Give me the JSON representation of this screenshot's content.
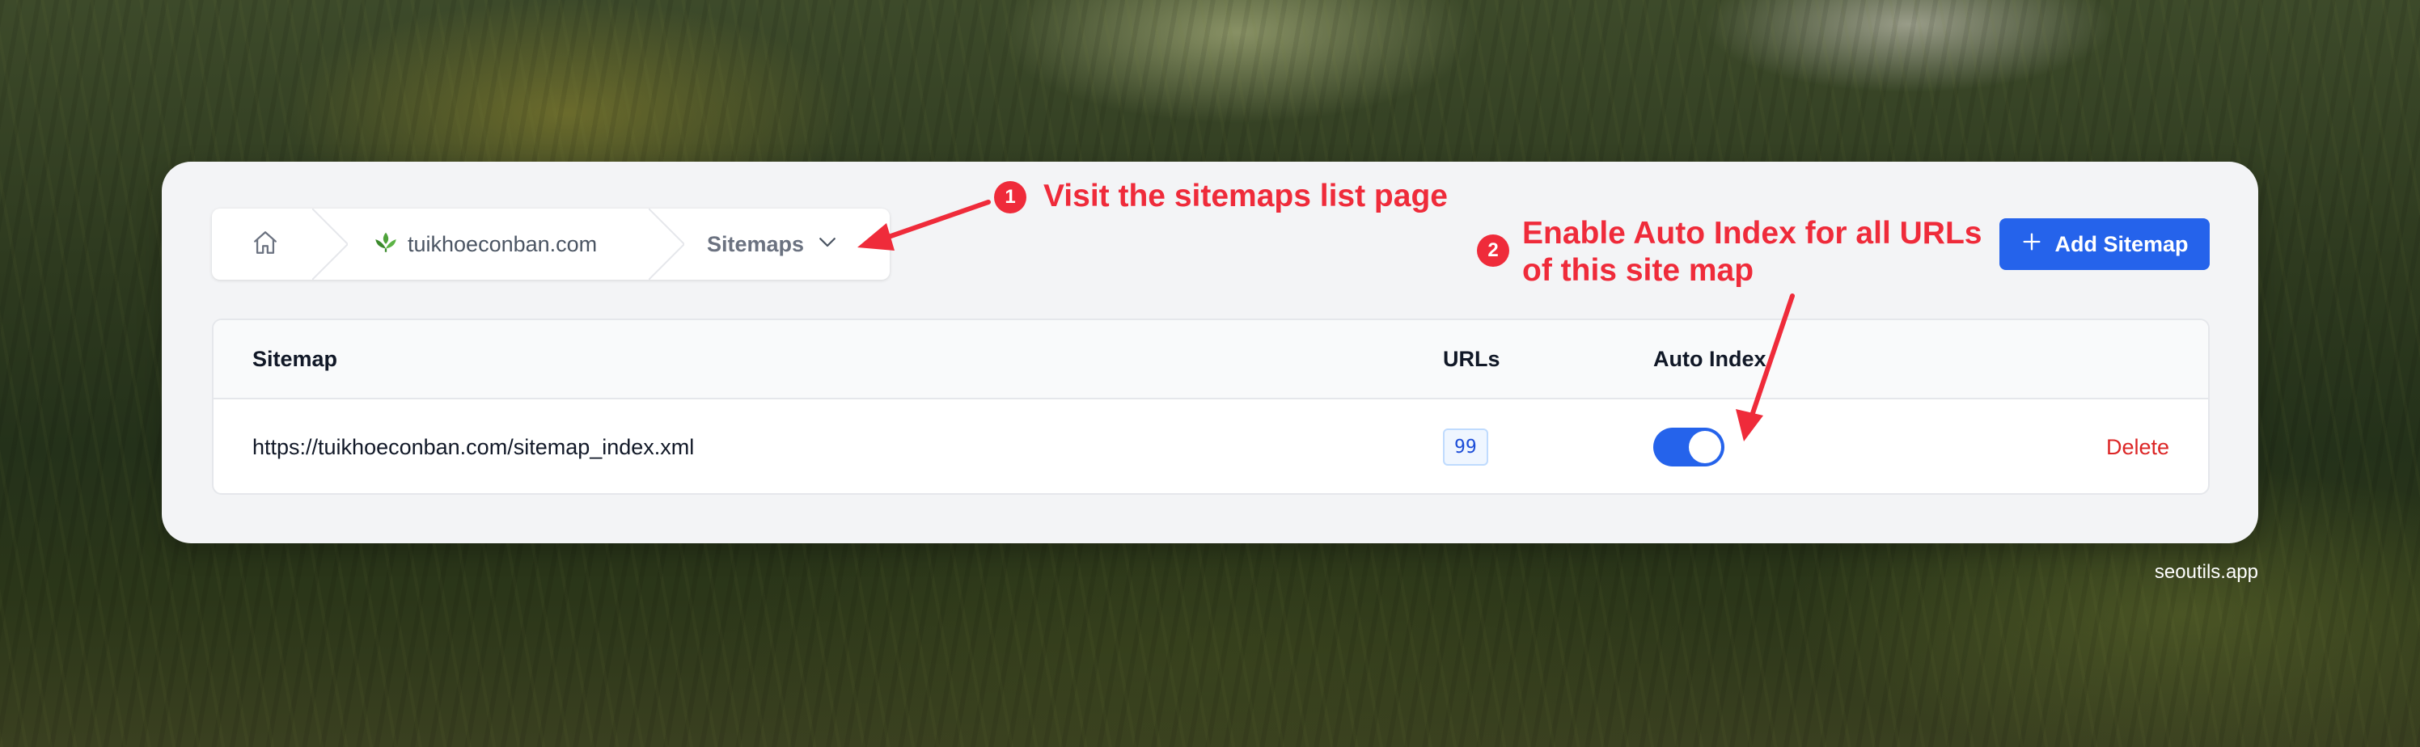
{
  "breadcrumb": {
    "site": "tuikhoeconban.com",
    "current": "Sitemaps"
  },
  "actions": {
    "add_sitemap": "Add Sitemap"
  },
  "table": {
    "headers": {
      "sitemap": "Sitemap",
      "urls": "URLs",
      "auto_index": "Auto Index"
    },
    "rows": [
      {
        "sitemap": "https://tuikhoeconban.com/sitemap_index.xml",
        "urls": "99",
        "auto_index": true,
        "delete": "Delete"
      }
    ]
  },
  "annotations": [
    {
      "number": "1",
      "text": "Visit the sitemaps list page"
    },
    {
      "number": "2",
      "text_line1": "Enable Auto Index for all URLs",
      "text_line2": "of this site map"
    }
  ],
  "footer": {
    "brand": "seoutils.app"
  },
  "colors": {
    "accent": "#2563eb",
    "danger": "#dc2626",
    "annotation": "#ef2b3a"
  }
}
